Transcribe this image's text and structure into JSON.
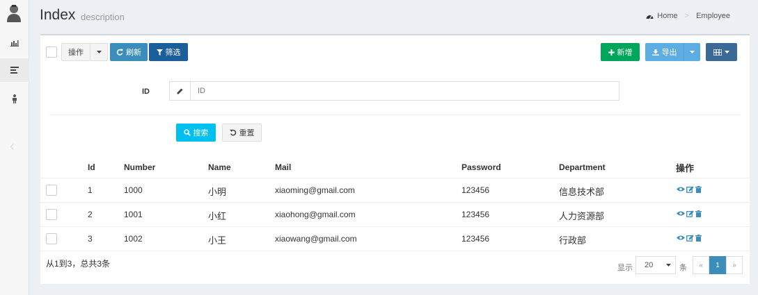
{
  "header": {
    "title": "Index",
    "description": "description",
    "breadcrumb": {
      "home": "Home",
      "current": "Employee"
    }
  },
  "toolbar": {
    "operate": "操作",
    "refresh": "刷新",
    "filter": "筛选",
    "add": "新增",
    "export": "导出"
  },
  "search": {
    "id_label": "ID",
    "id_placeholder": "ID",
    "submit": "搜索",
    "reset": "重置"
  },
  "table": {
    "columns": [
      "Id",
      "Number",
      "Name",
      "Mail",
      "Password",
      "Department",
      "操作"
    ],
    "rows": [
      {
        "id": "1",
        "number": "1000",
        "name": "小明",
        "mail": "xiaoming@gmail.com",
        "password": "123456",
        "department": "信息技术部"
      },
      {
        "id": "2",
        "number": "1001",
        "name": "小红",
        "mail": "xiaohong@gmail.com",
        "password": "123456",
        "department": "人力资源部"
      },
      {
        "id": "3",
        "number": "1002",
        "name": "小王",
        "mail": "xiaowang@gmail.com",
        "password": "123456",
        "department": "行政部"
      }
    ]
  },
  "footer": {
    "summary": "从1到3，总共3条",
    "show_label": "显示",
    "page_size": "20",
    "unit_label": "条",
    "prev": "«",
    "page": "1",
    "next": "»"
  },
  "colors": {
    "accent": "#3c8dbc",
    "success": "#00a65a",
    "cyan": "#00c0ef"
  }
}
